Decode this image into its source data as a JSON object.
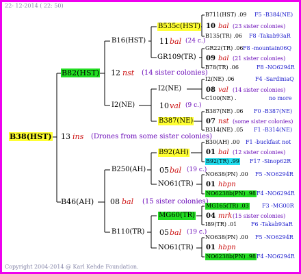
{
  "meta": {
    "date_top": "22- 12-2014 ( 22: 50)",
    "copyright": "Copyright 2004-2014 @ Karl Kehde Foundation."
  },
  "colors": {
    "border": "#ee00ee",
    "yellow": "#ffff33",
    "green": "#22dd22",
    "cyan": "#22ddee",
    "text_blue": "#1a1acc",
    "text_purple": "#6a0ab8",
    "text_red": "#cc1111"
  },
  "root": {
    "label": "B38(HST)",
    "num": "13",
    "code": "ins",
    "note": "(Drones from some sister colonies)"
  },
  "l1": [
    {
      "label": "B82(HST)",
      "num": "12",
      "code": "nst",
      "note": "(14 sister colonies)"
    },
    {
      "label": "B46(AH)",
      "num": "08",
      "code": "bal",
      "note": "(15 sister colonies)"
    }
  ],
  "l2": [
    {
      "label": "B16(HST)",
      "num": "11",
      "code": "bal",
      "note": "(24 c.)"
    },
    {
      "label": "I2(NE)",
      "num": "10",
      "code": "val",
      "note": "(9 c.)"
    },
    {
      "label": "B250(AH)",
      "num": "05",
      "code": "bal",
      "note": "(19 c.)"
    },
    {
      "label": "B110(TR)",
      "num": "05",
      "code": "bal",
      "note": "(19 c.)"
    }
  ],
  "l3": [
    {
      "label": "B535c(HST)"
    },
    {
      "label": "GR109(TR)"
    },
    {
      "label": "I2(NE)"
    },
    {
      "label": "B387(NE)"
    },
    {
      "label": "B92(AH)"
    },
    {
      "label": "NO61(TR)"
    },
    {
      "label": "MG60(TR)"
    },
    {
      "label": "NO61(TR)"
    }
  ],
  "l4": [
    {
      "a": "B711(HST) .09",
      "a2": "F5 -B384(NE)",
      "num": "10",
      "code": "bal",
      "note": "(23 sister colonies)",
      "b": "B135(TR) .06",
      "b2": "F8 -Takab93aR"
    },
    {
      "a": "GR22(TR) .06",
      "a2": "F8 -mountain06Q",
      "num": "09",
      "code": "bal",
      "note": "(21 sister colonies)",
      "b": "B78(TR) .06",
      "b2": "F8 -NO6294R"
    },
    {
      "a": "I2(NE) .06",
      "a2": "F4 -SardiniaQ",
      "num": "08",
      "code": "val",
      "note": "(14 sister colonies)",
      "b": "C100(NE) .",
      "b2": "no more"
    },
    {
      "a": "B387(NE) .06",
      "a2": "F0 -B387(NE)",
      "num": "07",
      "code": "nst",
      "note": "(some sister colonies)",
      "b": "B314(NE) .05",
      "b2": "F1 -B314(NE)"
    },
    {
      "a": "B30(AH) .00",
      "a2": "F1 -buckfast not",
      "num": "01",
      "code": "bal",
      "note": "(12 sister colonies)",
      "b": "B92(TR) .99",
      "b2": "F17 -Sinop62R"
    },
    {
      "a": "NO638(PN) .00",
      "a2": "F5 -NO6294R",
      "num": "01",
      "code": "hbpn",
      "note": "",
      "b": "NO6238b(PN) .98",
      "b2": "F4 -NO6294R"
    },
    {
      "a": "MG165(TR) .03",
      "a2": "F3 -MG00R",
      "num": "04",
      "code": "mrk",
      "note": "(15 sister colonies)",
      "b": "I89(TR) .01",
      "b2": "F6 -Takab93aR"
    },
    {
      "a": "NO638(PN) .00",
      "a2": "F5 -NO6294R",
      "num": "01",
      "code": "hbpn",
      "note": "",
      "b": "NO6238b(PN) .98",
      "b2": "F4 -NO6294R"
    }
  ]
}
